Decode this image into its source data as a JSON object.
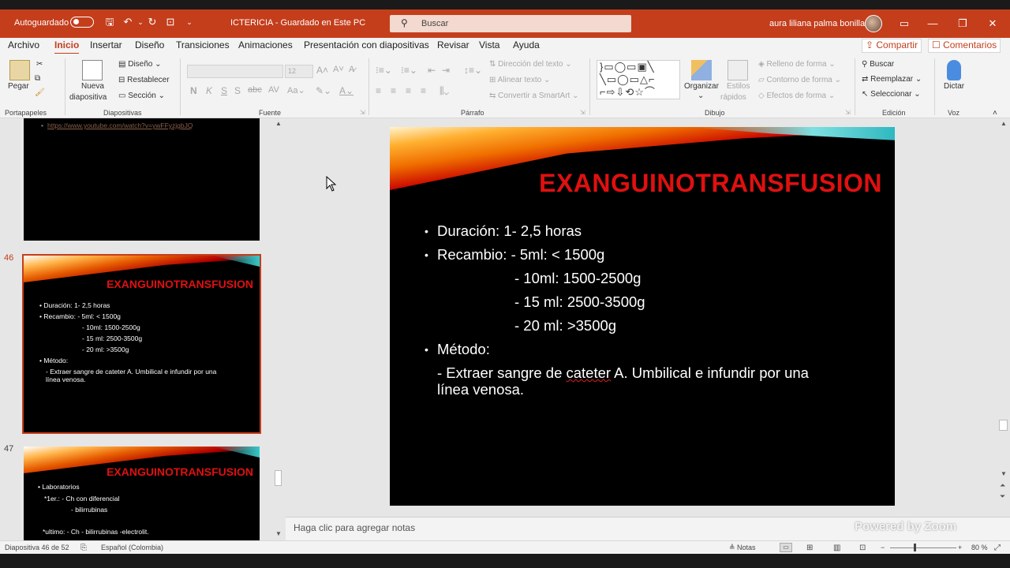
{
  "titlebar": {
    "autosave_label": "Autoguardado",
    "document_title": "ICTERICIA  -  Guardado en Este PC",
    "search_placeholder": "Buscar",
    "user_name": "aura liliana palma bonilla"
  },
  "menu": {
    "tabs": [
      "Archivo",
      "Inicio",
      "Insertar",
      "Diseño",
      "Transiciones",
      "Animaciones",
      "Presentación con diapositivas",
      "Revisar",
      "Vista",
      "Ayuda"
    ],
    "active_tab": "Inicio",
    "share_label": "Compartir",
    "comments_label": "Comentarios"
  },
  "ribbon": {
    "clipboard": {
      "paste": "Pegar",
      "group": "Portapapeles"
    },
    "slides": {
      "new_slide_1": "Nueva",
      "new_slide_2": "diapositiva",
      "layout": "Diseño",
      "reset": "Restablecer",
      "section": "Sección",
      "group": "Diapositivas"
    },
    "font": {
      "size": "12",
      "group": "Fuente"
    },
    "paragraph": {
      "text_direction": "Dirección del texto",
      "align_text": "Alinear texto",
      "smartart": "Convertir a SmartArt",
      "group": "Párrafo"
    },
    "drawing": {
      "arrange": "Organizar",
      "quick_styles_1": "Estilos",
      "quick_styles_2": "rápidos",
      "shape_fill": "Relleno de forma",
      "shape_outline": "Contorno de forma",
      "shape_effects": "Efectos de forma",
      "group": "Dibujo"
    },
    "editing": {
      "find": "Buscar",
      "replace": "Reemplazar",
      "select": "Seleccionar",
      "group": "Edición"
    },
    "voice": {
      "dictate": "Dictar",
      "group": "Voz"
    }
  },
  "thumbnails": {
    "prev_link": "https://www.youtube.com/watch?v=ywFFyzjgbJQ",
    "slide46": {
      "number": "46",
      "title": "EXANGUINOTRANSFUSION",
      "lines": [
        "• Duración: 1- 2,5 horas",
        "• Recambio: - 5ml: < 1500g",
        "- 10ml: 1500-2500g",
        "- 15 ml: 2500-3500g",
        "- 20 ml: >3500g",
        "• Método:",
        "- Extraer sangre de cateter A. Umbilical e infundir por una",
        "línea venosa."
      ]
    },
    "slide47": {
      "number": "47",
      "title": "EXANGUINOTRANSFUSION",
      "lines": [
        "• Laboratorios",
        "*1er.:     - Ch con diferencial",
        "- bilirrubinas",
        "*ultimo:    - Ch        - bilirrubinas   -electrolit."
      ]
    }
  },
  "slide": {
    "title": "EXANGUINOTRANSFUSION",
    "duracion": "Duración: 1- 2,5 horas",
    "recambio": "Recambio: - 5ml: < 1500g",
    "r10": "- 10ml: 1500-2500g",
    "r15": "- 15 ml: 2500-3500g",
    "r20": "- 20 ml: >3500g",
    "metodo": "Método:",
    "metodo_a": "- Extraer sangre de ",
    "metodo_b": "cateter",
    "metodo_c": " A. Umbilical e infundir por una",
    "metodo_d": "línea venosa."
  },
  "notes_placeholder": "Haga clic para agregar notas",
  "watermark": "Powered by Zoom",
  "status": {
    "slide_pos": "Diapositiva 46 de 52",
    "language": "Español (Colombia)",
    "notes": "Notas",
    "zoom": "80 %"
  },
  "colors": {
    "accent": "#c43e1c",
    "slide_title": "#e01010"
  }
}
